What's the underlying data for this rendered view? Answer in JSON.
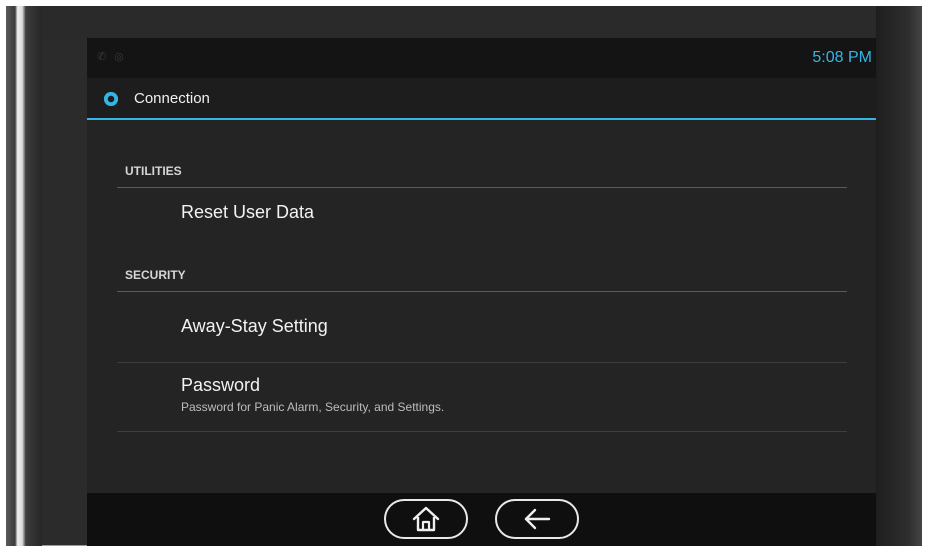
{
  "status_bar": {
    "icons": [
      "phone-icon",
      "alarm-icon"
    ],
    "time": "5:08 PM"
  },
  "action_bar": {
    "icon": "gear-icon",
    "title": "Connection"
  },
  "sections": [
    {
      "header": "UTILITIES",
      "items": [
        {
          "title": "Reset User Data",
          "subtitle": ""
        }
      ]
    },
    {
      "header": "SECURITY",
      "items": [
        {
          "title": "Away-Stay Setting",
          "subtitle": ""
        },
        {
          "title": "Password",
          "subtitle": "Password for Panic Alarm, Security, and Settings."
        }
      ]
    }
  ],
  "nav_bar": {
    "buttons": [
      "home-icon",
      "back-arrow-icon"
    ]
  },
  "colors": {
    "accent": "#33b5e5",
    "screen_bg": "#242424",
    "status_bg": "#141414",
    "nav_bg": "#0f0f0f"
  }
}
